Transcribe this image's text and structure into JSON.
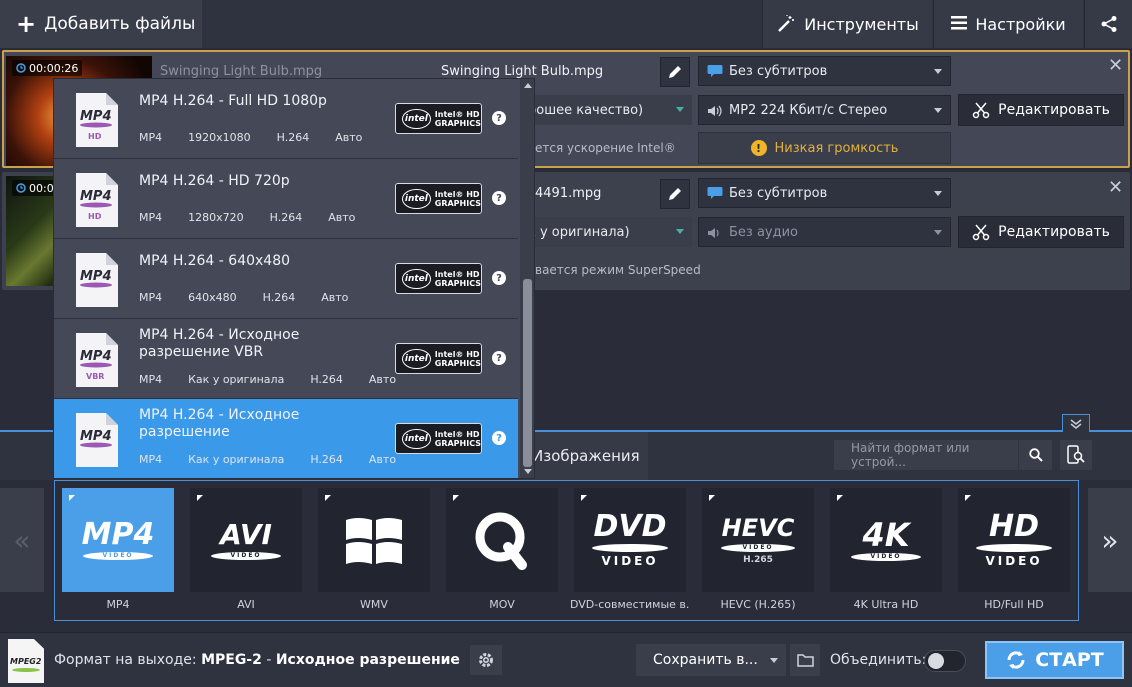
{
  "topbar": {
    "add_files": "Добавить файлы",
    "tools": "Инструменты",
    "settings": "Настройки"
  },
  "files": [
    {
      "time": "00:00:26",
      "name_dim": "Swinging Light Bulb.mpg",
      "name": "Swinging Light Bulb.mpg",
      "subtitles": "Без субтитров",
      "quality_partial": "рошее качество)",
      "audio": "MP2 224 Кбит/с Стерео",
      "edit": "Редактировать",
      "accel_partial": "ется ускорение Intel®",
      "warning": "Низкая громкость"
    },
    {
      "time": "00:0",
      "name_partial": "4491.mpg",
      "subtitles": "Без субтитров",
      "quality_partial": "к у оригинала)",
      "audio": "Без аудио",
      "edit": "Редактировать",
      "mode_partial": "вается режим SuperSpeed"
    }
  ],
  "presets": [
    {
      "title": "MP4 H.264 - Full HD 1080p",
      "specs": [
        "MP4",
        "1920x1080",
        "H.264",
        "Авто"
      ],
      "icon_tag": "HD"
    },
    {
      "title": "MP4 H.264 - HD 720p",
      "specs": [
        "MP4",
        "1280x720",
        "H.264",
        "Авто"
      ],
      "icon_tag": "HD"
    },
    {
      "title": "MP4 H.264 - 640x480",
      "specs": [
        "MP4",
        "640x480",
        "H.264",
        "Авто"
      ],
      "icon_tag": ""
    },
    {
      "title": "MP4 H.264 - Исходное разрешение VBR",
      "specs": [
        "MP4",
        "Как у оригинала",
        "H.264",
        "Авто"
      ],
      "icon_tag": "VBR"
    },
    {
      "title": "MP4 H.264 - Исходное разрешение",
      "specs": [
        "MP4",
        "Как у оригинала",
        "H.264",
        "Авто"
      ],
      "icon_tag": ""
    }
  ],
  "intel_badge": {
    "logo": "intel",
    "line1": "Intel® HD",
    "line2": "GRAPHICS"
  },
  "tabs": {
    "images": "Изображения"
  },
  "search": {
    "placeholder": "Найти формат или устрой..."
  },
  "formats": [
    {
      "label": "MP4",
      "logo": "MP4",
      "sub": "VIDEO"
    },
    {
      "label": "AVI",
      "logo": "AVI",
      "sub": "VIDEO"
    },
    {
      "label": "WMV",
      "logo": "",
      "sub": ""
    },
    {
      "label": "MOV",
      "logo": "Q",
      "sub": ""
    },
    {
      "label": "DVD-совместимые в...",
      "logo": "DVD",
      "sub": "VIDEO"
    },
    {
      "label": "HEVC (H.265)",
      "logo": "HEVC",
      "sub": "VIDEO",
      "sub2": "H.265"
    },
    {
      "label": "4K Ultra HD",
      "logo": "4K",
      "sub": "VIDEO"
    },
    {
      "label": "HD/Full HD",
      "logo": "HD",
      "sub": "VIDEO"
    }
  ],
  "bottom": {
    "output_label": "Формат на выходе:",
    "output_format": "MPEG-2",
    "output_sep": " - ",
    "output_res": "Исходное разрешение",
    "file_icon": "MPEG2",
    "save_to": "Сохранить в...",
    "merge": "Объединить:",
    "start": "СТАРТ"
  },
  "colors": {
    "accent": "#4a9fe8",
    "selected_border": "#c9a24b",
    "warning": "#f0b429"
  }
}
